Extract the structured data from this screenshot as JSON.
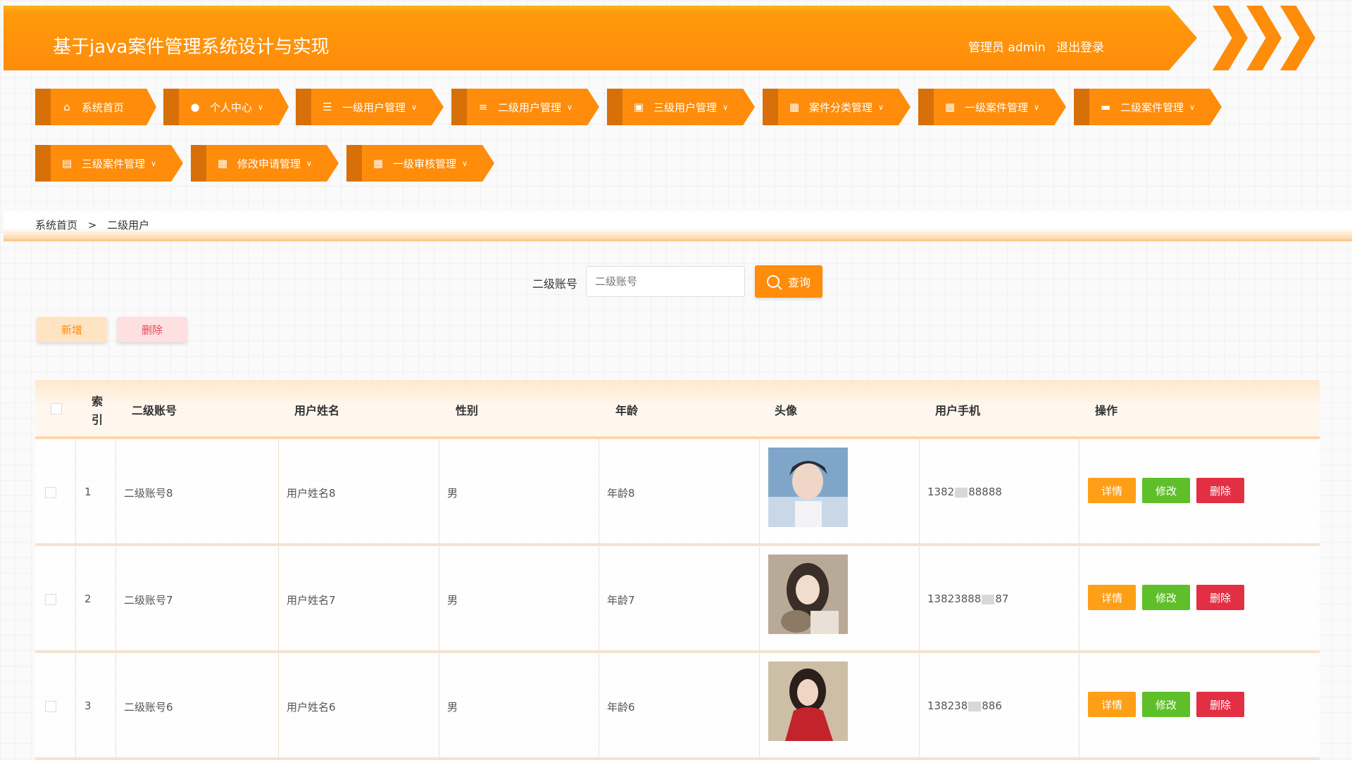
{
  "header": {
    "title": "基于java案件管理系统设计与实现",
    "user_label": "管理员 admin",
    "logout_label": "退出登录"
  },
  "nav": {
    "items": [
      {
        "label": "系统首页",
        "icon": "home-icon",
        "caret": false
      },
      {
        "label": "个人中心",
        "icon": "user-icon",
        "caret": true
      },
      {
        "label": "一级用户管理",
        "icon": "sliders-icon",
        "caret": true
      },
      {
        "label": "二级用户管理",
        "icon": "list-icon",
        "caret": true
      },
      {
        "label": "三级用户管理",
        "icon": "users-icon",
        "caret": true
      },
      {
        "label": "案件分类管理",
        "icon": "grid-icon",
        "caret": true
      },
      {
        "label": "一级案件管理",
        "icon": "grid-icon",
        "caret": true
      },
      {
        "label": "二级案件管理",
        "icon": "monitor-icon",
        "caret": true
      },
      {
        "label": "三级案件管理",
        "icon": "chart-icon",
        "caret": true
      },
      {
        "label": "修改申请管理",
        "icon": "grid-icon",
        "caret": true
      },
      {
        "label": "一级审核管理",
        "icon": "grid-icon",
        "caret": true
      }
    ]
  },
  "breadcrumb": {
    "home": "系统首页",
    "separator": ">",
    "current": "二级用户"
  },
  "search": {
    "label": "二级账号",
    "placeholder": "二级账号",
    "button_label": "查询"
  },
  "toolbar": {
    "add_label": "新增",
    "delete_label": "删除"
  },
  "table": {
    "headers": [
      "索引",
      "二级账号",
      "用户姓名",
      "性别",
      "年龄",
      "头像",
      "用户手机",
      "操作"
    ],
    "actions": {
      "detail": "详情",
      "edit": "修改",
      "delete": "删除"
    },
    "rows": [
      {
        "index": "1",
        "account": "二级账号8",
        "name": "用户姓名8",
        "gender": "男",
        "age": "年龄8",
        "phone_start": "1382",
        "phone_end": "88888"
      },
      {
        "index": "2",
        "account": "二级账号7",
        "name": "用户姓名7",
        "gender": "男",
        "age": "年龄7",
        "phone_start": "13823888",
        "phone_end": "87"
      },
      {
        "index": "3",
        "account": "二级账号6",
        "name": "用户姓名6",
        "gender": "男",
        "age": "年龄6",
        "phone_start": "138238",
        "phone_end": "886"
      }
    ]
  },
  "colors": {
    "accent": "#ff8c0b",
    "detail": "#ff9f17",
    "edit": "#5fbf2a",
    "delete": "#e22f44"
  }
}
